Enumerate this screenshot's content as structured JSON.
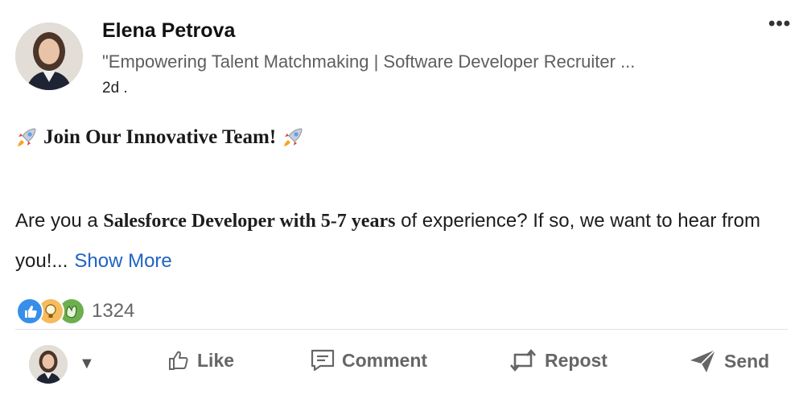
{
  "post": {
    "author_name": "Elena Petrova",
    "author_headline": "\"Empowering Talent Matchmaking | Software Developer Recruiter ...",
    "time": "2d .",
    "more_menu": "•••",
    "title": "Join Our Innovative Team!",
    "body_pre": "Are you a ",
    "body_bold": "Salesforce Developer with 5-7 years",
    "body_post": " of experience? If so, we want to hear from you!...",
    "show_more": "Show More"
  },
  "reactions": {
    "icons": [
      "like-icon",
      "insightful-icon",
      "celebrate-icon"
    ],
    "count": "1324"
  },
  "actions": {
    "caret": "▼",
    "like": "Like",
    "comment": "Comment",
    "repost": "Repost",
    "send": "Send"
  },
  "colors": {
    "link": "#1f63c4",
    "action_gray": "#666666",
    "like_blue": "#378fe9",
    "insight_yellow": "#f5bb5c",
    "celebrate_green": "#6dae4f"
  }
}
